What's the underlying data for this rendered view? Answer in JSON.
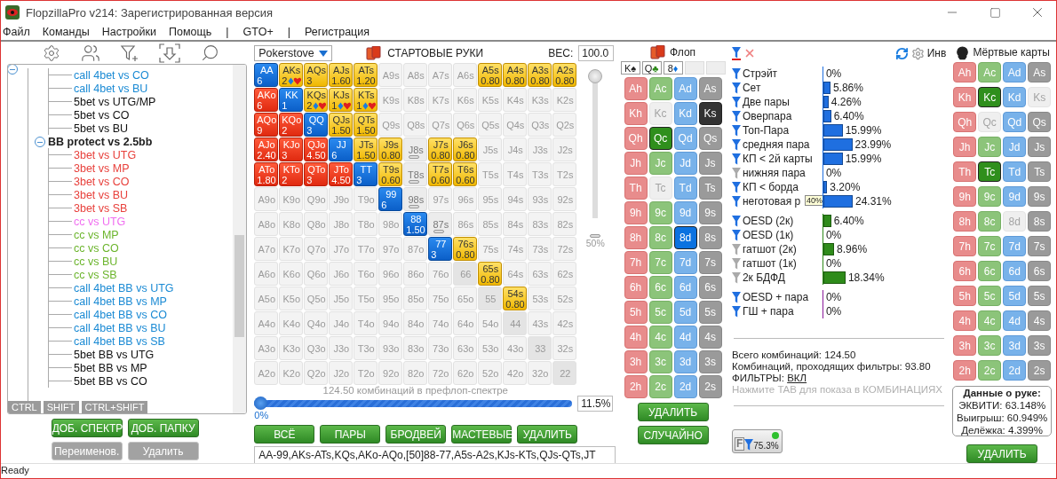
{
  "window": {
    "title": "FlopzillaPro v214: Зарегистрированная версия"
  },
  "menu": [
    {
      "label": "Файл",
      "kind": "item"
    },
    {
      "label": "Команды",
      "kind": "item"
    },
    {
      "label": "Настройки",
      "kind": "item"
    },
    {
      "label": "Помощь",
      "kind": "item"
    },
    {
      "label": "|",
      "kind": "separator"
    },
    {
      "label": "GTO+",
      "kind": "item"
    },
    {
      "label": "|",
      "kind": "separator"
    },
    {
      "label": "Регистрация",
      "kind": "item"
    }
  ],
  "tree": {
    "expanded": true,
    "children": [
      {
        "children": [
          {
            "label": "call 4bet vs CO",
            "color": "#1a8ad4"
          },
          {
            "label": "call 4bet vs BU",
            "color": "#1a8ad4"
          },
          {
            "label": "5bet vs UTG/MP",
            "color": "#111111"
          },
          {
            "label": "5bet vs CO",
            "color": "#111111"
          },
          {
            "label": "5bet vs BU",
            "color": "#111111"
          }
        ]
      },
      {
        "label": "BB protect vs 2.5bb",
        "expanded": true,
        "children": [
          {
            "label": "3bet vs UTG",
            "color": "#e8413c"
          },
          {
            "label": "3bet vs MP",
            "color": "#e8413c"
          },
          {
            "label": "3bet vs CO",
            "color": "#e8413c"
          },
          {
            "label": "3bet vs BU",
            "color": "#e8413c"
          },
          {
            "label": "3bet vs SB",
            "color": "#e8413c"
          },
          {
            "label": "cc vs UTG",
            "color": "#f06ef0"
          },
          {
            "label": "cc vs MP",
            "color": "#6cb52d"
          },
          {
            "label": "cc vs CO",
            "color": "#6cb52d"
          },
          {
            "label": "cc vs BU",
            "color": "#6cb52d"
          },
          {
            "label": "cc vs SB",
            "color": "#6cb52d"
          },
          {
            "label": "call 4bet BB vs UTG",
            "color": "#1a8ad4"
          },
          {
            "label": "call 4bet BB vs MP",
            "color": "#1a8ad4"
          },
          {
            "label": "call 4bet BB vs CO",
            "color": "#1a8ad4"
          },
          {
            "label": "call 4bet BB vs BU",
            "color": "#1a8ad4"
          },
          {
            "label": "call 4bet BB vs SB",
            "color": "#1a8ad4"
          },
          {
            "label": "5bet BB vs UTG",
            "color": "#111111"
          },
          {
            "label": "5bet BB vs MP",
            "color": "#111111"
          },
          {
            "label": "5bet BB vs CO",
            "color": "#111111"
          }
        ]
      }
    ]
  },
  "modifier_tabs": [
    "CTRL",
    "SHIFT",
    "CTRL+SHIFT"
  ],
  "tree_buttons": [
    {
      "label": "ДОБ. СПЕКТР",
      "disabled": false
    },
    {
      "label": "ДОБ. ПАПКУ",
      "disabled": false
    },
    {
      "label": "Переименов.",
      "disabled": true
    },
    {
      "label": "Удалить",
      "disabled": true
    }
  ],
  "range": {
    "source": "Pokerstove",
    "title": "СТАРТОВЫЕ РУКИ",
    "weight_label": "ВЕС:",
    "weight_value": "100.0",
    "weight_slider": {
      "level": 1,
      "reading": "50%"
    },
    "hand_grid": {
      "rows": [
        [
          {
            "label": "AA",
            "kind": "pair",
            "weight": "6"
          },
          {
            "label": "AKs",
            "kind": "suited",
            "weight": "2",
            "suits": true
          },
          {
            "label": "AQs",
            "kind": "suited",
            "weight": "3"
          },
          {
            "label": "AJs",
            "kind": "suited",
            "weight": "1.60"
          },
          {
            "label": "ATs",
            "kind": "suited",
            "weight": "1.20"
          },
          {
            "label": "A9s",
            "kind": "none"
          },
          {
            "label": "A8s",
            "kind": "none"
          },
          {
            "label": "A7s",
            "kind": "none"
          },
          {
            "label": "A6s",
            "kind": "none"
          },
          {
            "label": "A5s",
            "kind": "suited",
            "weight": "0.80"
          },
          {
            "label": "A4s",
            "kind": "suited",
            "weight": "0.80"
          },
          {
            "label": "A3s",
            "kind": "suited",
            "weight": "0.80"
          },
          {
            "label": "A2s",
            "kind": "suited",
            "weight": "0.80"
          }
        ],
        [
          {
            "label": "AKo",
            "kind": "offsuit",
            "weight": "6"
          },
          {
            "label": "KK",
            "kind": "pair",
            "weight": "1"
          },
          {
            "label": "KQs",
            "kind": "suited",
            "weight": "2",
            "suits": true
          },
          {
            "label": "KJs",
            "kind": "suited",
            "weight": "1",
            "suits": true
          },
          {
            "label": "KTs",
            "kind": "suited",
            "weight": "1",
            "suits": true
          },
          {
            "label": "K9s",
            "kind": "none"
          },
          {
            "label": "K8s",
            "kind": "none"
          },
          {
            "label": "K7s",
            "kind": "none"
          },
          {
            "label": "K6s",
            "kind": "none"
          },
          {
            "label": "K5s",
            "kind": "none"
          },
          {
            "label": "K4s",
            "kind": "none"
          },
          {
            "label": "K3s",
            "kind": "none"
          },
          {
            "label": "K2s",
            "kind": "none"
          }
        ],
        [
          {
            "label": "AQo",
            "kind": "offsuit",
            "weight": "9"
          },
          {
            "label": "KQo",
            "kind": "offsuit",
            "weight": "2"
          },
          {
            "label": "QQ",
            "kind": "pair",
            "weight": "3"
          },
          {
            "label": "QJs",
            "kind": "suited",
            "weight": "1.50"
          },
          {
            "label": "QTs",
            "kind": "suited",
            "weight": "1.50"
          },
          {
            "label": "Q9s",
            "kind": "none"
          },
          {
            "label": "Q8s",
            "kind": "none"
          },
          {
            "label": "Q7s",
            "kind": "none"
          },
          {
            "label": "Q6s",
            "kind": "none"
          },
          {
            "label": "Q5s",
            "kind": "none"
          },
          {
            "label": "Q4s",
            "kind": "none"
          },
          {
            "label": "Q3s",
            "kind": "none"
          },
          {
            "label": "Q2s",
            "kind": "none"
          }
        ],
        [
          {
            "label": "AJo",
            "kind": "offsuit",
            "weight": "2.40"
          },
          {
            "label": "KJo",
            "kind": "offsuit",
            "weight": "3"
          },
          {
            "label": "QJo",
            "kind": "offsuit",
            "weight": "4.50"
          },
          {
            "label": "JJ",
            "kind": "pair",
            "weight": "6"
          },
          {
            "label": "JTs",
            "kind": "suited",
            "weight": "1.50"
          },
          {
            "label": "J9s",
            "kind": "suited",
            "weight": "0.80"
          },
          {
            "label": "J8s",
            "kind": "partial"
          },
          {
            "label": "J7s",
            "kind": "suited",
            "weight": "0.80"
          },
          {
            "label": "J6s",
            "kind": "suited",
            "weight": "0.80"
          },
          {
            "label": "J5s",
            "kind": "none"
          },
          {
            "label": "J4s",
            "kind": "none"
          },
          {
            "label": "J3s",
            "kind": "none"
          },
          {
            "label": "J2s",
            "kind": "none"
          }
        ],
        [
          {
            "label": "ATo",
            "kind": "offsuit",
            "weight": "1.80"
          },
          {
            "label": "KTo",
            "kind": "offsuit",
            "weight": "2"
          },
          {
            "label": "QTo",
            "kind": "offsuit",
            "weight": "3"
          },
          {
            "label": "JTo",
            "kind": "offsuit",
            "weight": "4.50"
          },
          {
            "label": "TT",
            "kind": "pair",
            "weight": "3"
          },
          {
            "label": "T9s",
            "kind": "suited",
            "weight": "0.60"
          },
          {
            "label": "T8s",
            "kind": "partial"
          },
          {
            "label": "T7s",
            "kind": "suited",
            "weight": "0.60"
          },
          {
            "label": "T6s",
            "kind": "suited",
            "weight": "0.60"
          },
          {
            "label": "T5s",
            "kind": "none"
          },
          {
            "label": "T4s",
            "kind": "none"
          },
          {
            "label": "T3s",
            "kind": "none"
          },
          {
            "label": "T2s",
            "kind": "none"
          }
        ],
        [
          {
            "label": "A9o",
            "kind": "none"
          },
          {
            "label": "K9o",
            "kind": "none"
          },
          {
            "label": "Q9o",
            "kind": "none"
          },
          {
            "label": "J9o",
            "kind": "none"
          },
          {
            "label": "T9o",
            "kind": "none"
          },
          {
            "label": "99",
            "kind": "pair",
            "weight": "6"
          },
          {
            "label": "98s",
            "kind": "partial"
          },
          {
            "label": "97s",
            "kind": "none"
          },
          {
            "label": "96s",
            "kind": "none"
          },
          {
            "label": "95s",
            "kind": "none"
          },
          {
            "label": "94s",
            "kind": "none"
          },
          {
            "label": "93s",
            "kind": "none"
          },
          {
            "label": "92s",
            "kind": "none"
          }
        ],
        [
          {
            "label": "A8o",
            "kind": "none"
          },
          {
            "label": "K8o",
            "kind": "none"
          },
          {
            "label": "Q8o",
            "kind": "none"
          },
          {
            "label": "J8o",
            "kind": "none"
          },
          {
            "label": "T8o",
            "kind": "none"
          },
          {
            "label": "98o",
            "kind": "none"
          },
          {
            "label": "88",
            "kind": "pair",
            "weight": "1.50"
          },
          {
            "label": "87s",
            "kind": "partial"
          },
          {
            "label": "86s",
            "kind": "none"
          },
          {
            "label": "85s",
            "kind": "none"
          },
          {
            "label": "84s",
            "kind": "none"
          },
          {
            "label": "83s",
            "kind": "none"
          },
          {
            "label": "82s",
            "kind": "none"
          }
        ],
        [
          {
            "label": "A7o",
            "kind": "none"
          },
          {
            "label": "K7o",
            "kind": "none"
          },
          {
            "label": "Q7o",
            "kind": "none"
          },
          {
            "label": "J7o",
            "kind": "none"
          },
          {
            "label": "T7o",
            "kind": "none"
          },
          {
            "label": "97o",
            "kind": "none"
          },
          {
            "label": "87o",
            "kind": "none"
          },
          {
            "label": "77",
            "kind": "pair",
            "weight": "3"
          },
          {
            "label": "76s",
            "kind": "suited",
            "weight": "0.80"
          },
          {
            "label": "75s",
            "kind": "none"
          },
          {
            "label": "74s",
            "kind": "none"
          },
          {
            "label": "73s",
            "kind": "none"
          },
          {
            "label": "72s",
            "kind": "none"
          }
        ],
        [
          {
            "label": "A6o",
            "kind": "none"
          },
          {
            "label": "K6o",
            "kind": "none"
          },
          {
            "label": "Q6o",
            "kind": "none"
          },
          {
            "label": "J6o",
            "kind": "none"
          },
          {
            "label": "T6o",
            "kind": "none"
          },
          {
            "label": "96o",
            "kind": "none"
          },
          {
            "label": "86o",
            "kind": "none"
          },
          {
            "label": "76o",
            "kind": "none"
          },
          {
            "label": "66",
            "kind": "none"
          },
          {
            "label": "65s",
            "kind": "suited",
            "weight": "0.80"
          },
          {
            "label": "64s",
            "kind": "none"
          },
          {
            "label": "63s",
            "kind": "none"
          },
          {
            "label": "62s",
            "kind": "none"
          }
        ],
        [
          {
            "label": "A5o",
            "kind": "none"
          },
          {
            "label": "K5o",
            "kind": "none"
          },
          {
            "label": "Q5o",
            "kind": "none"
          },
          {
            "label": "J5o",
            "kind": "none"
          },
          {
            "label": "T5o",
            "kind": "none"
          },
          {
            "label": "95o",
            "kind": "none"
          },
          {
            "label": "85o",
            "kind": "none"
          },
          {
            "label": "75o",
            "kind": "none"
          },
          {
            "label": "65o",
            "kind": "none"
          },
          {
            "label": "55",
            "kind": "none"
          },
          {
            "label": "54s",
            "kind": "suited",
            "weight": "0.80"
          },
          {
            "label": "53s",
            "kind": "none"
          },
          {
            "label": "52s",
            "kind": "none"
          }
        ],
        [
          {
            "label": "A4o",
            "kind": "none"
          },
          {
            "label": "K4o",
            "kind": "none"
          },
          {
            "label": "Q4o",
            "kind": "none"
          },
          {
            "label": "J4o",
            "kind": "none"
          },
          {
            "label": "T4o",
            "kind": "none"
          },
          {
            "label": "94o",
            "kind": "none"
          },
          {
            "label": "84o",
            "kind": "none"
          },
          {
            "label": "74o",
            "kind": "none"
          },
          {
            "label": "64o",
            "kind": "none"
          },
          {
            "label": "54o",
            "kind": "none"
          },
          {
            "label": "44",
            "kind": "none"
          },
          {
            "label": "43s",
            "kind": "none"
          },
          {
            "label": "42s",
            "kind": "none"
          }
        ],
        [
          {
            "label": "A3o",
            "kind": "none"
          },
          {
            "label": "K3o",
            "kind": "none"
          },
          {
            "label": "Q3o",
            "kind": "none"
          },
          {
            "label": "J3o",
            "kind": "none"
          },
          {
            "label": "T3o",
            "kind": "none"
          },
          {
            "label": "93o",
            "kind": "none"
          },
          {
            "label": "83o",
            "kind": "none"
          },
          {
            "label": "73o",
            "kind": "none"
          },
          {
            "label": "63o",
            "kind": "none"
          },
          {
            "label": "53o",
            "kind": "none"
          },
          {
            "label": "43o",
            "kind": "none"
          },
          {
            "label": "33",
            "kind": "none"
          },
          {
            "label": "32s",
            "kind": "none"
          }
        ],
        [
          {
            "label": "A2o",
            "kind": "none"
          },
          {
            "label": "K2o",
            "kind": "none"
          },
          {
            "label": "Q2o",
            "kind": "none"
          },
          {
            "label": "J2o",
            "kind": "none"
          },
          {
            "label": "T2o",
            "kind": "none"
          },
          {
            "label": "92o",
            "kind": "none"
          },
          {
            "label": "82o",
            "kind": "none"
          },
          {
            "label": "72o",
            "kind": "none"
          },
          {
            "label": "62o",
            "kind": "none"
          },
          {
            "label": "52o",
            "kind": "none"
          },
          {
            "label": "42o",
            "kind": "none"
          },
          {
            "label": "32o",
            "kind": "none"
          },
          {
            "label": "22",
            "kind": "none"
          }
        ]
      ]
    },
    "combos_caption": "124.50 комбинаций в префлоп-спектре",
    "percent_slider": {
      "level": 0,
      "reading": "0%",
      "value": "11.5%"
    },
    "buttons": [
      "ВСЁ",
      "ПАРЫ",
      "БРОДВЕЙ",
      "МАСТЕВЫЕ",
      "УДАЛИТЬ"
    ],
    "range_text": "AA-99,AKs-ATs,KQs,AKo-AQo,[50]88-77,A5s-A2s,KJs-KTs,QJs-QTs,JT"
  },
  "flop": {
    "title": "Флоп",
    "slots": [
      {
        "empty": false,
        "rank": "K",
        "suit": "♠",
        "color": "#222222"
      },
      {
        "empty": false,
        "rank": "Q",
        "suit": "♣",
        "color": "#2e8b1a"
      },
      {
        "empty": false,
        "rank": "8",
        "suit": "♦",
        "color": "#0b72e0"
      },
      {
        "empty": true
      },
      {
        "empty": true
      }
    ],
    "cards": [
      {
        "label": "Ah",
        "selected": false,
        "disabled": false
      },
      {
        "label": "Ac",
        "selected": false,
        "disabled": false
      },
      {
        "label": "Ad",
        "selected": false,
        "disabled": false
      },
      {
        "label": "As",
        "selected": false,
        "disabled": false
      },
      {
        "label": "Kh",
        "selected": false,
        "disabled": false
      },
      {
        "label": "Kc",
        "selected": false,
        "disabled": true
      },
      {
        "label": "Kd",
        "selected": false,
        "disabled": false
      },
      {
        "label": "Ks",
        "selected": true,
        "disabled": false
      },
      {
        "label": "Qh",
        "selected": false,
        "disabled": false
      },
      {
        "label": "Qc",
        "selected": true,
        "disabled": false
      },
      {
        "label": "Qd",
        "selected": false,
        "disabled": false
      },
      {
        "label": "Qs",
        "selected": false,
        "disabled": false
      },
      {
        "label": "Jh",
        "selected": false,
        "disabled": false
      },
      {
        "label": "Jc",
        "selected": false,
        "disabled": false
      },
      {
        "label": "Jd",
        "selected": false,
        "disabled": false
      },
      {
        "label": "Js",
        "selected": false,
        "disabled": false
      },
      {
        "label": "Th",
        "selected": false,
        "disabled": false
      },
      {
        "label": "Tc",
        "selected": false,
        "disabled": true
      },
      {
        "label": "Td",
        "selected": false,
        "disabled": false
      },
      {
        "label": "Ts",
        "selected": false,
        "disabled": false
      },
      {
        "label": "9h",
        "selected": false,
        "disabled": false
      },
      {
        "label": "9c",
        "selected": false,
        "disabled": false
      },
      {
        "label": "9d",
        "selected": false,
        "disabled": false
      },
      {
        "label": "9s",
        "selected": false,
        "disabled": false
      },
      {
        "label": "8h",
        "selected": false,
        "disabled": false
      },
      {
        "label": "8c",
        "selected": false,
        "disabled": false
      },
      {
        "label": "8d",
        "selected": true,
        "disabled": false
      },
      {
        "label": "8s",
        "selected": false,
        "disabled": false
      },
      {
        "label": "7h",
        "selected": false,
        "disabled": false
      },
      {
        "label": "7c",
        "selected": false,
        "disabled": false
      },
      {
        "label": "7d",
        "selected": false,
        "disabled": false
      },
      {
        "label": "7s",
        "selected": false,
        "disabled": false
      },
      {
        "label": "6h",
        "selected": false,
        "disabled": false
      },
      {
        "label": "6c",
        "selected": false,
        "disabled": false
      },
      {
        "label": "6d",
        "selected": false,
        "disabled": false
      },
      {
        "label": "6s",
        "selected": false,
        "disabled": false
      },
      {
        "label": "5h",
        "selected": false,
        "disabled": false
      },
      {
        "label": "5c",
        "selected": false,
        "disabled": false
      },
      {
        "label": "5d",
        "selected": false,
        "disabled": false
      },
      {
        "label": "5s",
        "selected": false,
        "disabled": false
      },
      {
        "label": "4h",
        "selected": false,
        "disabled": false
      },
      {
        "label": "4c",
        "selected": false,
        "disabled": false
      },
      {
        "label": "4d",
        "selected": false,
        "disabled": false
      },
      {
        "label": "4s",
        "selected": false,
        "disabled": false
      },
      {
        "label": "3h",
        "selected": false,
        "disabled": false
      },
      {
        "label": "3c",
        "selected": false,
        "disabled": false
      },
      {
        "label": "3d",
        "selected": false,
        "disabled": false
      },
      {
        "label": "3s",
        "selected": false,
        "disabled": false
      },
      {
        "label": "2h",
        "selected": false,
        "disabled": false
      },
      {
        "label": "2c",
        "selected": false,
        "disabled": false
      },
      {
        "label": "2d",
        "selected": false,
        "disabled": false
      },
      {
        "label": "2s",
        "selected": false,
        "disabled": false
      }
    ],
    "buttons": [
      "УДАЛИТЬ",
      "СЛУЧАЙНО"
    ]
  },
  "stats": {
    "invert_label": "Инв",
    "groups": [
      [
        {
          "label": "Стрэйт",
          "active": true,
          "value": "0%"
        },
        {
          "label": "Сет",
          "active": true,
          "level": 0.0586,
          "value": "5.86%"
        },
        {
          "label": "Две пары",
          "active": true,
          "level": 0.0426,
          "value": "4.26%"
        },
        {
          "label": "Оверпара",
          "active": true,
          "level": 0.064,
          "value": "6.40%"
        },
        {
          "label": "Топ-Пара",
          "active": true,
          "level": 0.1599,
          "value": "15.99%"
        },
        {
          "label": "средняя пара",
          "active": true,
          "level": 0.2399,
          "value": "23.99%"
        },
        {
          "label": "КП < 2й карты",
          "active": true,
          "level": 0.1599,
          "value": "15.99%"
        },
        {
          "label": "нижняя пара",
          "active": false,
          "value": "0%"
        },
        {
          "label": "КП < борда",
          "active": true,
          "level": 0.032,
          "value": "3.20%"
        },
        {
          "label": "неготовая р",
          "active": true,
          "level": 0.2431,
          "value": "24.31%",
          "tooltip": "40%"
        }
      ],
      [
        {
          "label": "OESD (2к)",
          "active": true,
          "level": 0.064,
          "value": "6.40%"
        },
        {
          "label": "OESD (1к)",
          "active": true,
          "value": "0%"
        },
        {
          "label": "гатшот (2к)",
          "active": false,
          "level": 0.0896,
          "value": "8.96%"
        },
        {
          "label": "гатшот (1к)",
          "active": false,
          "value": "0%"
        },
        {
          "label": "2к БДФД",
          "active": false,
          "level": 0.1834,
          "value": "18.34%"
        }
      ],
      [
        {
          "label": "OESD + пара",
          "active": true,
          "value": "0%"
        },
        {
          "label": "ГШ + пара",
          "active": true,
          "value": "0%"
        }
      ]
    ],
    "total": "Всего комбинаций: 124.50",
    "passing": "Комбинаций, проходящих фильтры: 93.80",
    "filters_label": "ФИЛЬТРЫ:",
    "filters_link": "ВКЛ",
    "hint": "Нажмите TAB для показа в КОМБИНАЦИЯХ",
    "f_button": {
      "letter": "F",
      "value": "75.3%"
    }
  },
  "dead": {
    "title": "Мёртвые карты",
    "cards": [
      {
        "label": "Ah",
        "selected": false,
        "disabled": false
      },
      {
        "label": "Ac",
        "selected": false,
        "disabled": false
      },
      {
        "label": "Ad",
        "selected": false,
        "disabled": false
      },
      {
        "label": "As",
        "selected": false,
        "disabled": false
      },
      {
        "label": "Kh",
        "selected": false,
        "disabled": false
      },
      {
        "label": "Kc",
        "selected": true,
        "disabled": false
      },
      {
        "label": "Kd",
        "selected": false,
        "disabled": false
      },
      {
        "label": "Ks",
        "selected": false,
        "disabled": true
      },
      {
        "label": "Qh",
        "selected": false,
        "disabled": false
      },
      {
        "label": "Qc",
        "selected": false,
        "disabled": true
      },
      {
        "label": "Qd",
        "selected": false,
        "disabled": false
      },
      {
        "label": "Qs",
        "selected": false,
        "disabled": false
      },
      {
        "label": "Jh",
        "selected": false,
        "disabled": false
      },
      {
        "label": "Jc",
        "selected": false,
        "disabled": false
      },
      {
        "label": "Jd",
        "selected": false,
        "disabled": false
      },
      {
        "label": "Js",
        "selected": false,
        "disabled": false
      },
      {
        "label": "Th",
        "selected": false,
        "disabled": false
      },
      {
        "label": "Tc",
        "selected": true,
        "disabled": false
      },
      {
        "label": "Td",
        "selected": false,
        "disabled": false
      },
      {
        "label": "Ts",
        "selected": false,
        "disabled": false
      },
      {
        "label": "9h",
        "selected": false,
        "disabled": false
      },
      {
        "label": "9c",
        "selected": false,
        "disabled": false
      },
      {
        "label": "9d",
        "selected": false,
        "disabled": false
      },
      {
        "label": "9s",
        "selected": false,
        "disabled": false
      },
      {
        "label": "8h",
        "selected": false,
        "disabled": false
      },
      {
        "label": "8c",
        "selected": false,
        "disabled": false
      },
      {
        "label": "8d",
        "selected": false,
        "disabled": true
      },
      {
        "label": "8s",
        "selected": false,
        "disabled": false
      },
      {
        "label": "7h",
        "selected": false,
        "disabled": false
      },
      {
        "label": "7c",
        "selected": false,
        "disabled": false
      },
      {
        "label": "7d",
        "selected": false,
        "disabled": false
      },
      {
        "label": "7s",
        "selected": false,
        "disabled": false
      },
      {
        "label": "6h",
        "selected": false,
        "disabled": false
      },
      {
        "label": "6c",
        "selected": false,
        "disabled": false
      },
      {
        "label": "6d",
        "selected": false,
        "disabled": false
      },
      {
        "label": "6s",
        "selected": false,
        "disabled": false
      },
      {
        "label": "5h",
        "selected": false,
        "disabled": false
      },
      {
        "label": "5c",
        "selected": false,
        "disabled": false
      },
      {
        "label": "5d",
        "selected": false,
        "disabled": false
      },
      {
        "label": "5s",
        "selected": false,
        "disabled": false
      },
      {
        "label": "4h",
        "selected": false,
        "disabled": false
      },
      {
        "label": "4c",
        "selected": false,
        "disabled": false
      },
      {
        "label": "4d",
        "selected": false,
        "disabled": false
      },
      {
        "label": "4s",
        "selected": false,
        "disabled": false
      },
      {
        "label": "3h",
        "selected": false,
        "disabled": false
      },
      {
        "label": "3c",
        "selected": false,
        "disabled": false
      },
      {
        "label": "3d",
        "selected": false,
        "disabled": false
      },
      {
        "label": "3s",
        "selected": false,
        "disabled": false
      },
      {
        "label": "2h",
        "selected": false,
        "disabled": false
      },
      {
        "label": "2c",
        "selected": false,
        "disabled": false
      },
      {
        "label": "2d",
        "selected": false,
        "disabled": false
      },
      {
        "label": "2s",
        "selected": false,
        "disabled": false
      }
    ],
    "hand_info": {
      "title": "Данные о руке:",
      "lines": [
        "ЭКВИТИ: 63.148%",
        "Выигрыш: 60.949%",
        "Делёжка: 4.399%"
      ]
    },
    "button": "УДАЛИТЬ"
  },
  "status_bar": "Ready"
}
